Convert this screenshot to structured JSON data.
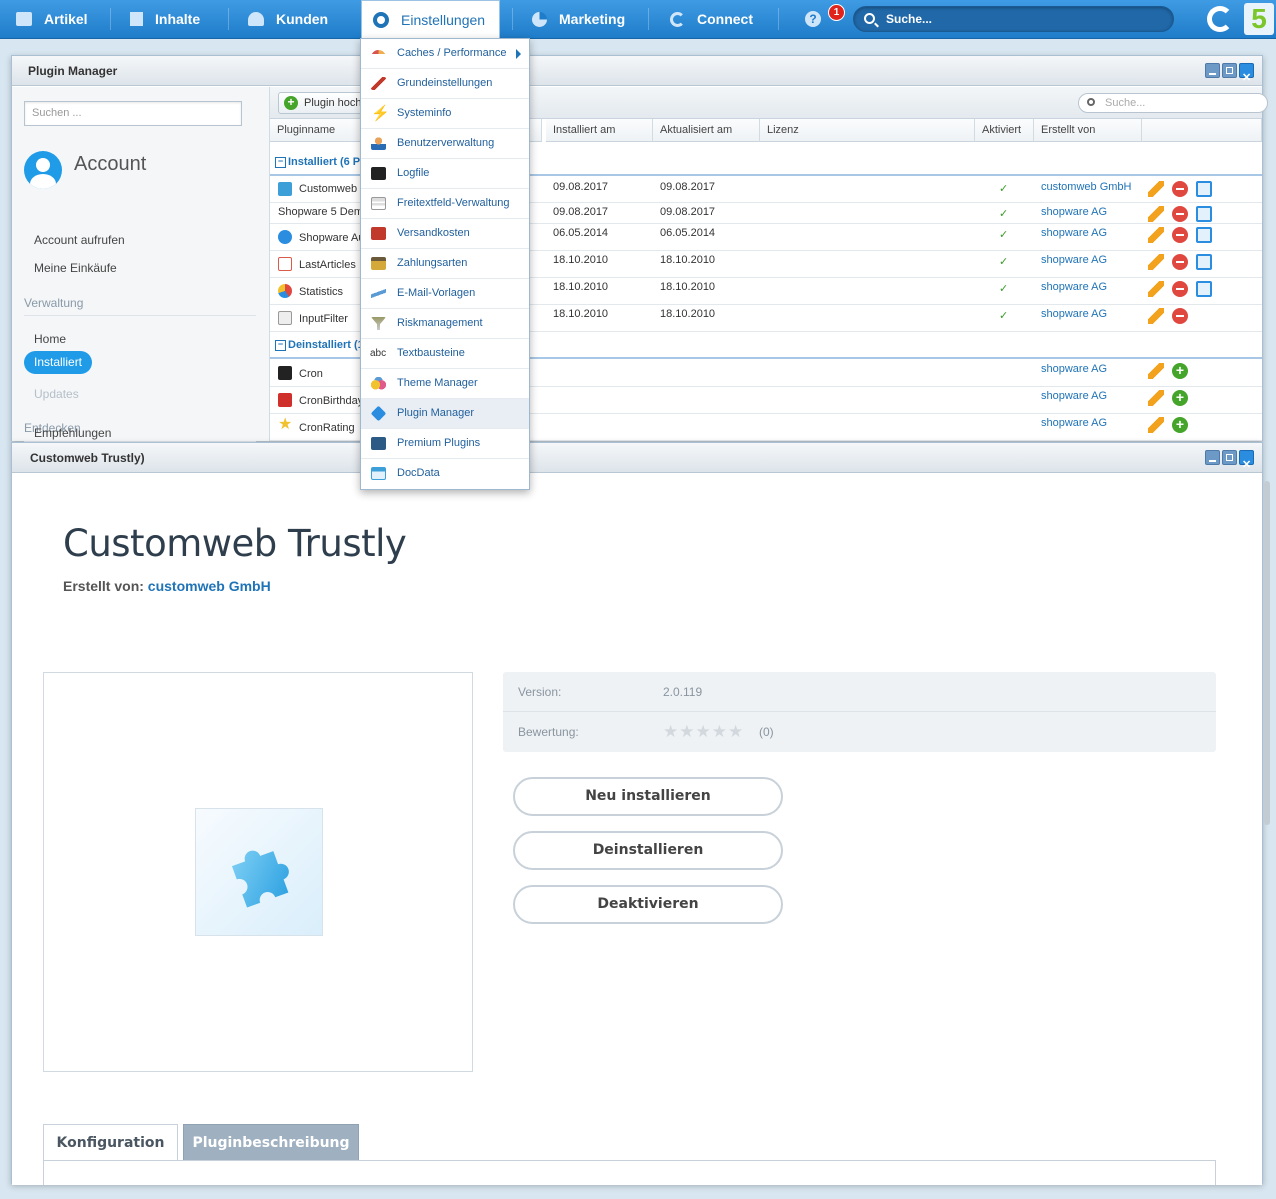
{
  "nav": {
    "items": [
      {
        "label": "Artikel",
        "icon": "articles-icon"
      },
      {
        "label": "Inhalte",
        "icon": "content-icon"
      },
      {
        "label": "Kunden",
        "icon": "customers-icon"
      },
      {
        "label": "Einstellungen",
        "icon": "gear-icon"
      },
      {
        "label": "Marketing",
        "icon": "pie-icon"
      },
      {
        "label": "Connect",
        "icon": "connect-icon"
      }
    ],
    "help_icon": "?",
    "notification_count": "1",
    "search_placeholder": "Suche...",
    "logo_text": "5"
  },
  "plugin_manager": {
    "title": "Plugin Manager",
    "sidebar": {
      "search_placeholder": "Suchen ...",
      "account_title": "Account",
      "account_links": [
        "Account aufrufen",
        "Meine Einkäufe"
      ],
      "section_verwaltung": "Verwaltung",
      "verwaltung_links": [
        "Home",
        "Installiert",
        "Updates"
      ],
      "section_entdecken": "Entdecken",
      "entdecken_links": [
        "Empfehlungen"
      ]
    },
    "toolbar": {
      "upload_label": "Plugin hochl",
      "search_placeholder": "Suche..."
    },
    "columns": [
      "Pluginname",
      "Installiert am",
      "Aktualisiert am",
      "Lizenz",
      "Aktiviert",
      "Erstellt von"
    ],
    "group_installed": "Installiert (6 P",
    "group_uninstalled": "Deinstalliert (1",
    "installed_rows": [
      {
        "name": "Customweb I",
        "installed": "09.08.2017",
        "updated": "09.08.2017",
        "active": "✓",
        "author": "customweb GmbH",
        "icon_color": "#3d9fd8"
      },
      {
        "name": "Shopware 5 Dem",
        "installed": "09.08.2017",
        "updated": "09.08.2017",
        "active": "✓",
        "author": "shopware AG",
        "icon_color": ""
      },
      {
        "name": "Shopware Au",
        "installed": "06.05.2014",
        "updated": "06.05.2014",
        "active": "✓",
        "author": "shopware AG",
        "icon_color": "#2a8de0"
      },
      {
        "name": "LastArticles",
        "installed": "18.10.2010",
        "updated": "18.10.2010",
        "active": "✓",
        "author": "shopware AG",
        "icon_color": "#d95b4a"
      },
      {
        "name": "Statistics",
        "installed": "18.10.2010",
        "updated": "18.10.2010",
        "active": "✓",
        "author": "shopware AG",
        "icon_color": "#e0483f"
      },
      {
        "name": "InputFilter",
        "installed": "18.10.2010",
        "updated": "18.10.2010",
        "active": "✓",
        "author": "shopware AG",
        "icon_color": "#999999"
      }
    ],
    "uninstalled_rows": [
      {
        "name": "Cron",
        "author": "shopware AG",
        "icon_color": "#222222"
      },
      {
        "name": "CronBirthday",
        "author": "shopware AG",
        "icon_color": "#d0302b"
      },
      {
        "name": "CronRating",
        "author": "shopware AG",
        "icon_color": "#f2c12e"
      }
    ]
  },
  "settings_menu": {
    "items": [
      {
        "label": "Caches / Performance",
        "icon": "speedometer-icon",
        "color": "#d9534f",
        "submenu": true
      },
      {
        "label": "Grundeinstellungen",
        "icon": "wrench-icon",
        "color": "#c0392b"
      },
      {
        "label": "Systeminfo",
        "icon": "lightning-icon",
        "color": "#f0a030"
      },
      {
        "label": "Benutzerverwaltung",
        "icon": "user-icon",
        "color": "#e08a3a"
      },
      {
        "label": "Logfile",
        "icon": "terminal-icon",
        "color": "#222222"
      },
      {
        "label": "Freitextfeld-Verwaltung",
        "icon": "field-add-icon",
        "color": "#7fb04a"
      },
      {
        "label": "Versandkosten",
        "icon": "truck-icon",
        "color": "#c0392b"
      },
      {
        "label": "Zahlungsarten",
        "icon": "credit-card-icon",
        "color": "#8a6d3b"
      },
      {
        "label": "E-Mail-Vorlagen",
        "icon": "mail-icon",
        "color": "#5b9bd5"
      },
      {
        "label": "Riskmanagement",
        "icon": "filter-warning-icon",
        "color": "#999966"
      },
      {
        "label": "Textbausteine",
        "icon": "text-abc-icon",
        "color": "#333333"
      },
      {
        "label": "Theme Manager",
        "icon": "color-circles-icon",
        "color": "#e05a8a"
      },
      {
        "label": "Plugin Manager",
        "icon": "puzzle-icon",
        "color": "#2a8de0",
        "highlighted": true
      },
      {
        "label": "Premium Plugins",
        "icon": "shopware-logo-icon",
        "color": "#2b5a84"
      },
      {
        "label": "DocData",
        "icon": "window-icon",
        "color": "#3d9fd8"
      }
    ]
  },
  "detail": {
    "window_title": "Customweb Trustly)",
    "plugin_title": "Customweb Trustly",
    "created_by_label": "Erstellt von:",
    "created_by_value": "customweb GmbH",
    "version_label": "Version:",
    "version_value": "2.0.119",
    "rating_label": "Bewertung:",
    "rating_stars": "★★★★★",
    "rating_count": "(0)",
    "buttons": {
      "reinstall": "Neu installieren",
      "uninstall": "Deinstallieren",
      "deactivate": "Deaktivieren"
    },
    "tabs": {
      "config": "Konfiguration",
      "description": "Pluginbeschreibung"
    }
  },
  "colors": {
    "accent": "#1f9be8",
    "nav_bg": "#2a86d3",
    "link": "#1f73b7"
  }
}
